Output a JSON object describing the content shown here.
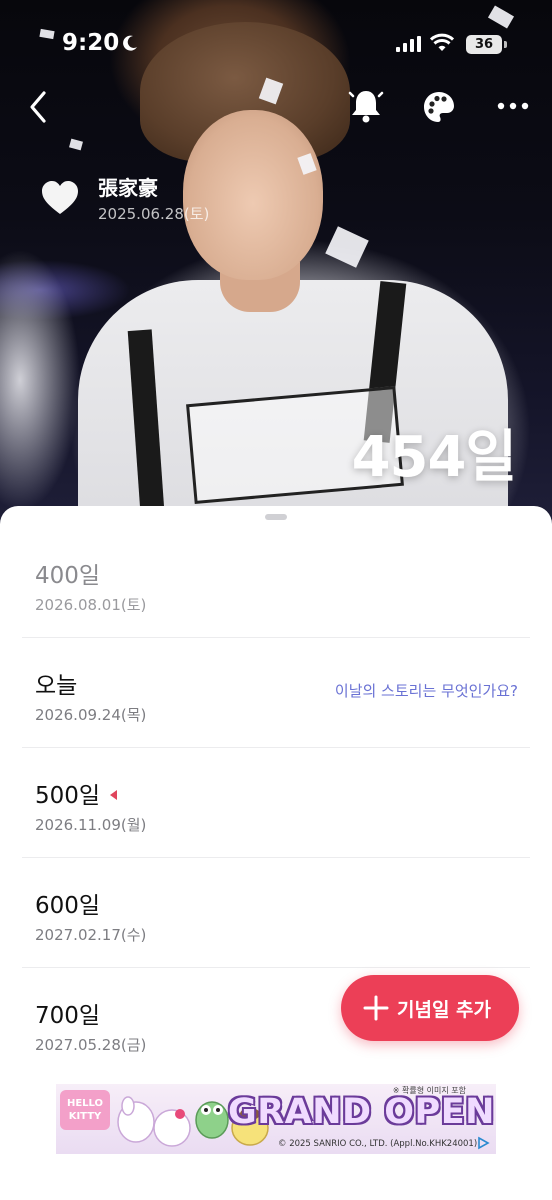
{
  "status_bar": {
    "time": "9:20",
    "battery": "36"
  },
  "profile": {
    "name": "張家豪",
    "start_date": "2025.06.28(토)",
    "dday": "454일"
  },
  "list": {
    "items": [
      {
        "title": "400일",
        "date": "2026.08.01(토)",
        "state": "past"
      },
      {
        "title": "오늘",
        "date": "2026.09.24(목)",
        "link": "이날의 스토리는 무엇인가요?"
      },
      {
        "title": "500일",
        "date": "2026.11.09(월)",
        "marker": "next-marker"
      },
      {
        "title": "600일",
        "date": "2027.02.17(수)"
      },
      {
        "title": "700일",
        "date": "2027.05.28(금)"
      }
    ]
  },
  "fab": {
    "label": "기념일 추가",
    "icon": "plus-icon"
  },
  "ad": {
    "headline": "GRAND OPEN",
    "logo": "HELLO KITTY",
    "top_note": "※ 확률형 이미지 포함",
    "copyright": "© 2025 SANRIO CO., LTD. (Appl.No.KHK24001)"
  },
  "colors": {
    "accent": "#ec3f57",
    "link": "#6a72d4",
    "muted_text": "#7d7d82"
  },
  "icons": [
    "back-icon",
    "bell-icon",
    "palette-icon",
    "more-icon",
    "heart-icon",
    "moon-icon",
    "signal-icon",
    "wifi-icon",
    "adchoices-icon"
  ]
}
